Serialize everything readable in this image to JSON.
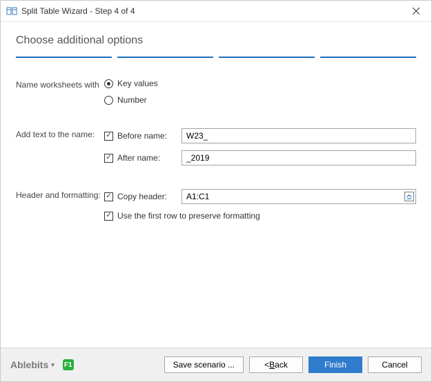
{
  "window": {
    "title": "Split Table Wizard - Step 4 of 4"
  },
  "step": {
    "title": "Choose additional options"
  },
  "sections": {
    "name_worksheets": {
      "label": "Name worksheets with",
      "options": {
        "key_values": "Key values",
        "number": "Number"
      },
      "selected": "key_values"
    },
    "add_text": {
      "label": "Add text to the name:",
      "before": {
        "label": "Before name:",
        "value": "W23_"
      },
      "after": {
        "label": "After name:",
        "value": "_2019"
      }
    },
    "header_formatting": {
      "label": "Header and formatting:",
      "copy_header": {
        "label": "Copy header:",
        "value": "A1:C1"
      },
      "use_first_row": {
        "label": "Use the first row to preserve formatting"
      }
    }
  },
  "footer": {
    "brand": "Ablebits",
    "help": "F1",
    "save_scenario": "Save scenario ...",
    "back_prefix": "< ",
    "back_u": "B",
    "back_rest": "ack",
    "finish": "Finish",
    "cancel": "Cancel"
  }
}
